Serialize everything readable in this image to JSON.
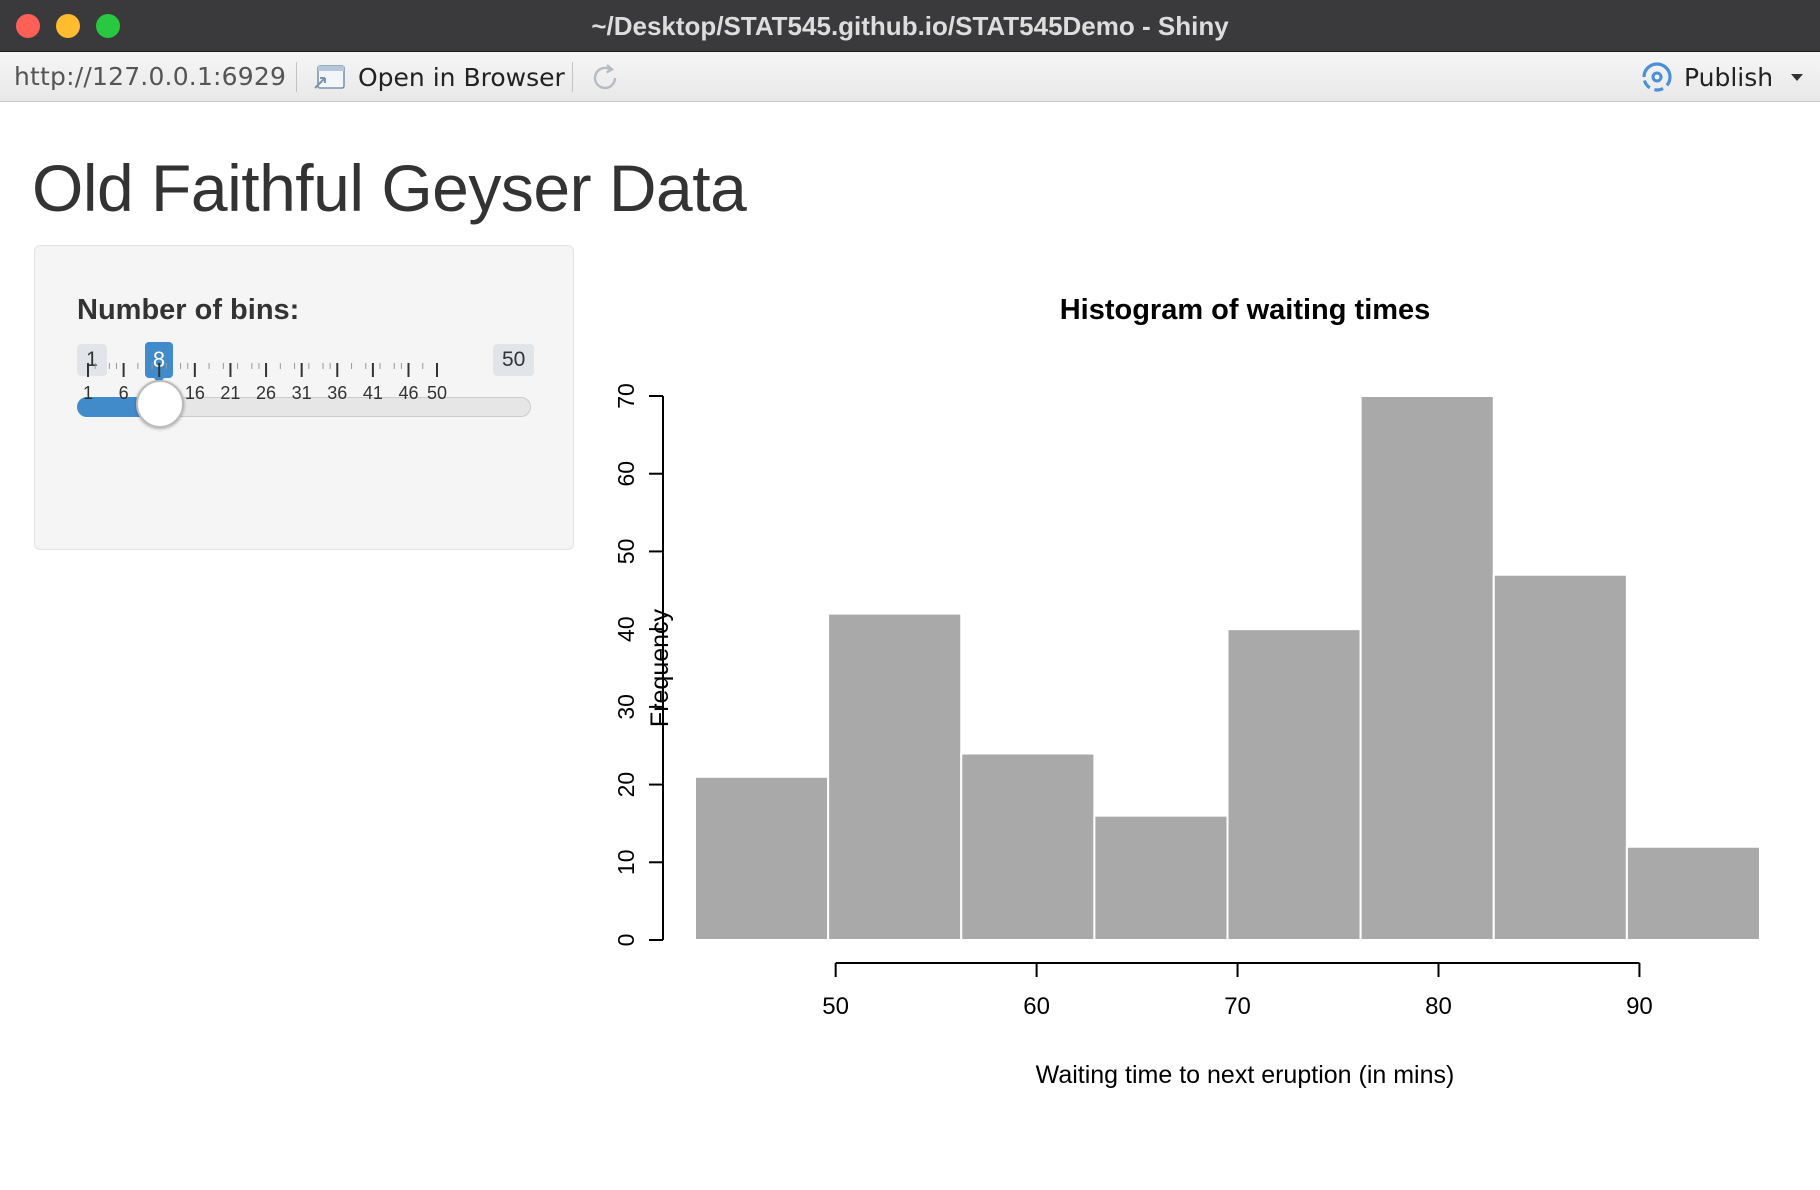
{
  "window": {
    "title": "~/Desktop/STAT545.github.io/STAT545Demo - Shiny"
  },
  "toolbar": {
    "url": "http://127.0.0.1:6929",
    "open_in_browser": "Open in Browser",
    "publish": "Publish"
  },
  "page": {
    "title": "Old Faithful Geyser Data"
  },
  "slider": {
    "label": "Number of bins:",
    "min": "1",
    "max": "50",
    "value": "8",
    "tick_labels": [
      "1",
      "6",
      "11",
      "16",
      "21",
      "26",
      "31",
      "36",
      "41",
      "46",
      "50"
    ]
  },
  "colors": {
    "accent": "#428bca",
    "bar_fill": "#a9a9a9",
    "bar_border": "#ffffff"
  },
  "chart_data": {
    "type": "bar",
    "title": "Histogram of waiting times",
    "xlabel": "Waiting time to next eruption (in mins)",
    "ylabel": "Frequency",
    "bin_edges": [
      43,
      49.625,
      56.25,
      62.875,
      69.5,
      76.125,
      82.75,
      89.375,
      96
    ],
    "values": [
      21,
      42,
      24,
      16,
      40,
      70,
      47,
      12
    ],
    "xlim": [
      43,
      96
    ],
    "ylim": [
      0,
      70
    ],
    "x_ticks": [
      "50",
      "60",
      "70",
      "80",
      "90"
    ],
    "y_ticks": [
      "0",
      "10",
      "20",
      "30",
      "40",
      "50",
      "60",
      "70"
    ],
    "grid": false,
    "legend": "none"
  }
}
